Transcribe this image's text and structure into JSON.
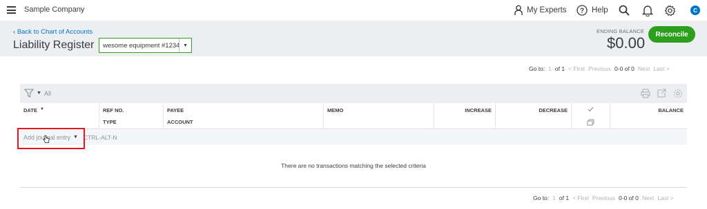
{
  "topbar": {
    "company": "Sample Company",
    "experts_label": "My Experts",
    "help_label": "Help",
    "avatar_initial": "C",
    "icons": [
      "hamburger-icon",
      "person-icon",
      "help-icon",
      "search-icon",
      "bell-icon",
      "gear-icon"
    ]
  },
  "header": {
    "back_link": "Back to Chart of Accounts",
    "title": "Liability Register",
    "account_select_value": "wesome equipment #1234",
    "ending_balance_label": "ENDING BALANCE",
    "ending_balance_value": "$0.00",
    "reconcile_label": "Reconcile"
  },
  "pager": {
    "goto_label": "Go to:",
    "page": "1",
    "of_label": "of 1",
    "first": "< First",
    "previous": "Previous",
    "range": "0-0 of 0",
    "next": "Next",
    "last": "Last >"
  },
  "filter": {
    "value": "All"
  },
  "table": {
    "headers": {
      "date": "DATE",
      "ref_no": "REF NO.",
      "type": "TYPE",
      "payee": "PAYEE",
      "account": "ACCOUNT",
      "memo": "MEMO",
      "increase": "INCREASE",
      "decrease": "DECREASE",
      "balance": "BALANCE"
    }
  },
  "add_entry": {
    "label": "Add journal entry",
    "shortcut": "CTRL-ALT-N"
  },
  "empty_message": "There are no transactions matching the selected criteria",
  "colors": {
    "accent_green": "#2ca01c",
    "link_blue": "#0077c5",
    "highlight_red": "#e8141c"
  }
}
